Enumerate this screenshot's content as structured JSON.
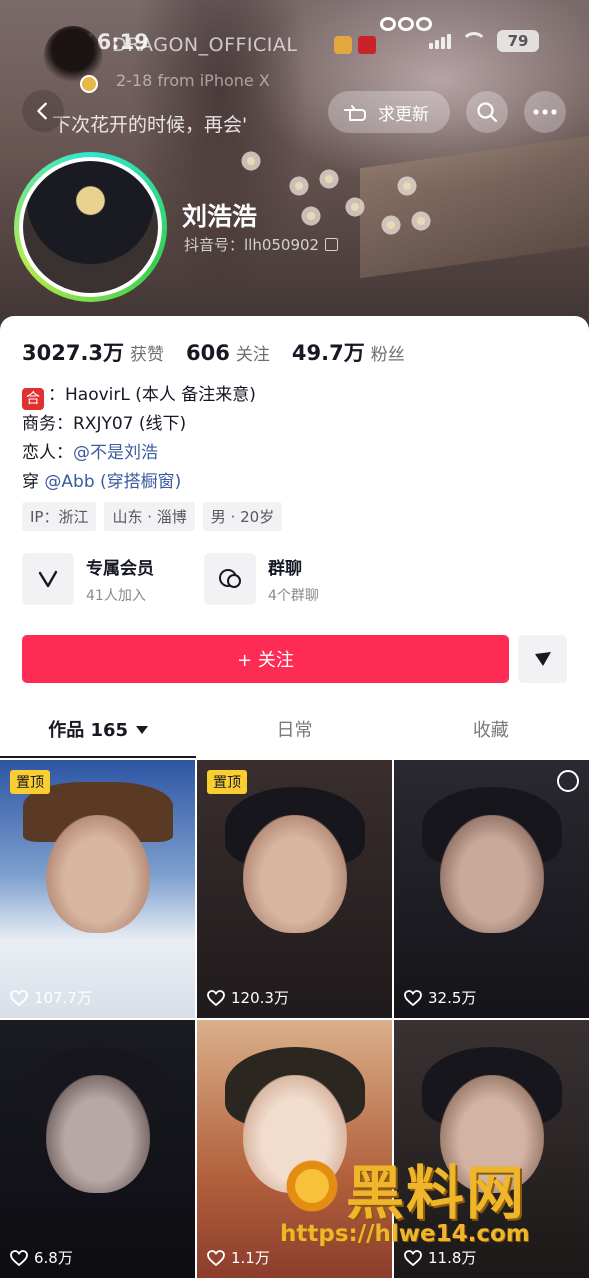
{
  "status_bar": {
    "time": "16:19",
    "battery": "79"
  },
  "post_overlay": {
    "author": "DRAGON_OFFICIAL",
    "date": "2-18  from iPhone X",
    "caption": "下次花开的时候，再会'"
  },
  "top_actions": {
    "update_label": "求更新"
  },
  "profile": {
    "name": "刘浩浩",
    "douyin_id": "抖音号：llh050902"
  },
  "stats": [
    {
      "num": "3027.3万",
      "label": "获赞"
    },
    {
      "num": "606",
      "label": "关注"
    },
    {
      "num": "49.7万",
      "label": "粉丝"
    }
  ],
  "bio": {
    "line1_badge": "合",
    "line1": "：HaovirL (本人 备注来意)",
    "line2": "商务：RXJY07 (线下)",
    "line3_prefix": "恋人：",
    "line3_link": "@不是刘浩",
    "line4_prefix": "穿 ",
    "line4_link": "@Abb (穿搭橱窗)"
  },
  "tags": [
    "IP：浙江",
    "山东 · 淄博",
    "男 · 20岁"
  ],
  "features": [
    {
      "title": "专属会员",
      "sub": "41人加入",
      "icon": "v-icon"
    },
    {
      "title": "群聊",
      "sub": "4个群聊",
      "icon": "chat-icon"
    }
  ],
  "follow_label": "+ 关注",
  "tabs": [
    "作品 165",
    "日常",
    "收藏"
  ],
  "videos": [
    {
      "pin": "置顶",
      "likes": "107.7万",
      "bg": "#5b79a7"
    },
    {
      "pin": "置顶",
      "likes": "120.3万",
      "bg": "#3d3030"
    },
    {
      "pin": "",
      "likes": "32.5万",
      "bg": "#2d2a2e"
    },
    {
      "pin": "",
      "likes": "6.8万",
      "bg": "#1f1f26"
    },
    {
      "pin": "",
      "likes": "1.1万",
      "bg": "#b88d6a"
    },
    {
      "pin": "",
      "likes": "11.8万",
      "bg": "#2c2626"
    }
  ],
  "watermark": {
    "title": "黑料网",
    "url": "https://hlwe14.com"
  },
  "colors": {
    "accent": "#fe2c55",
    "link": "#3a5ba0",
    "pin": "#facd31"
  }
}
